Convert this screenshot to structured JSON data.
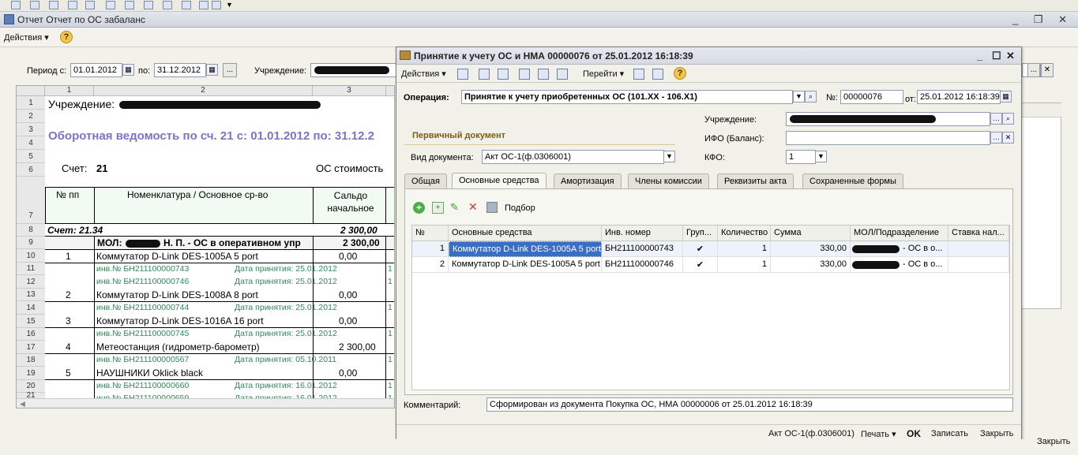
{
  "main_window": {
    "title": "Отчет  Отчет по ОС забаланс",
    "actions_label": "Действия ▾",
    "period_label": "Период с:",
    "period_from": "01.01.2012",
    "period_to_label": "по:",
    "period_to": "31.12.2012",
    "more_btn": "...",
    "institution_label": "Учреждение:",
    "close_btn": "Закрыть"
  },
  "report": {
    "col_numbers": [
      "1",
      "2",
      "3"
    ],
    "row_numbers": [
      "1",
      "2",
      "3",
      "4",
      "5",
      "6",
      "7",
      "8",
      "9",
      "10",
      "11",
      "12",
      "13",
      "14",
      "15",
      "16",
      "17",
      "18",
      "19",
      "20",
      "21"
    ],
    "institution_line": "Учреждение:",
    "title": "Оборотная ведомость по сч. 21 с: 01.01.2012 по: 31.12.2",
    "account_label": "Счет:",
    "account_value": "21",
    "os_cost": "ОС стоимость",
    "hdr_num": "№ пп",
    "hdr_nomen": "Номенклатура / Основное ср-во",
    "hdr_saldo": "Сальдо начальное",
    "account_row": "Счет: 21.34",
    "account_row_sum": "2 300,00",
    "mol_row": "МОЛ:",
    "mol_row_rest": "Н. П. - ОС в оперативном упр",
    "mol_row_sum": "2 300,00",
    "items": [
      {
        "num": "1",
        "name": "Коммутатор D-Link DES-1005A 5 port",
        "sum": "0,00",
        "inv": "инв.№ БН211100000743",
        "date": "Дата принятия: 25.01.2012",
        "tail": "1"
      },
      {
        "inv_only": "инв.№ БН211100000746",
        "date": "Дата принятия: 25.01.2012",
        "tail": "1"
      },
      {
        "num": "2",
        "name": "Коммутатор D-Link DES-1008A 8 port",
        "sum": "0,00",
        "inv": "инв.№ БН211100000744",
        "date": "Дата принятия: 25.01.2012",
        "tail": "1"
      },
      {
        "num": "3",
        "name": "Коммутатор D-Link DES-1016A 16 port",
        "sum": "0,00",
        "inv": "инв.№ БН211100000745",
        "date": "Дата принятия: 25.01.2012",
        "tail": "1"
      },
      {
        "num": "4",
        "name": "Метеостанция (гидрометр-барометр)",
        "sum": "2 300,00",
        "inv": "инв.№ БН211100000567",
        "date": "Дата принятия: 05.10.2011",
        "tail": "1"
      },
      {
        "num": "5",
        "name": "НАУШНИКИ Oklick black",
        "sum": "0,00",
        "inv": "инв.№ БН211100000660",
        "date": "Дата принятия: 16.01.2012",
        "tail": "1"
      },
      {
        "inv_only": "инв.№ БН211100000659",
        "date": "Дата принятия: 16.01.2012",
        "tail": "1"
      }
    ]
  },
  "modal": {
    "title": "Принятие к учету ОС и НМА 00000076 от 25.01.2012 16:18:39",
    "toolbar": {
      "actions": "Действия ▾",
      "goto": "Перейти ▾"
    },
    "operation_label": "Операция:",
    "operation_value": "Принятие к учету приобретенных ОС (101.ХХ - 106.Х1)",
    "number_label": "№:",
    "number_value": "00000076",
    "date_label": "от:",
    "date_value": "25.01.2012 16:18:39",
    "primary_doc_label": "Первичный документ",
    "doc_type_label": "Вид документа:",
    "doc_type_value": "Акт ОС-1(ф.0306001)",
    "institution_label": "Учреждение:",
    "ifo_label": "ИФО (Баланс):",
    "kfo_label": "КФО:",
    "kfo_value": "1",
    "tabs": [
      "Общая",
      "Основные средства",
      "Амортизация",
      "Члены комиссии",
      "Реквизиты акта",
      "Сохраненные формы"
    ],
    "active_tab": 1,
    "selection_label": "Подбор",
    "grid": {
      "headers": [
        "№",
        "Основные средства",
        "Инв. номер",
        "Груп...",
        "Количество",
        "Сумма",
        "МОЛ/Подразделение",
        "Ставка нал..."
      ],
      "rows": [
        {
          "num": "1",
          "name": "Коммутатор D-Link DES-1005A 5 port",
          "inv": "БН211100000743",
          "group": "✔",
          "qty": "1",
          "sum": "330,00",
          "mol": "- ОС в о..."
        },
        {
          "num": "2",
          "name": "Коммутатор D-Link DES-1005A 5 port",
          "inv": "БН211100000746",
          "group": "✔",
          "qty": "1",
          "sum": "330,00",
          "mol": "- ОС в о..."
        }
      ]
    },
    "comment_label": "Комментарий:",
    "comment_value": "Сформирован из документа Покупка ОС, НМА 00000006 от 25.01.2012 16:18:39",
    "footer": {
      "form": "Акт ОС-1(ф.0306001)",
      "print": "Печать ▾",
      "ok": "OK",
      "save": "Записать",
      "close": "Закрыть"
    }
  }
}
